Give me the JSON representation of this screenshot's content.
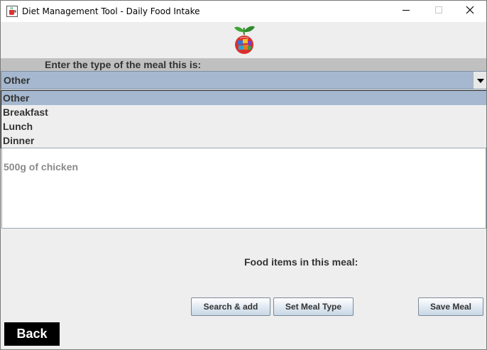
{
  "window": {
    "title": "Diet Management Tool - Daily Food Intake"
  },
  "icons": {
    "app": "java-cup-icon",
    "logo": "apple-plant-logo",
    "minimize": "minimize-icon",
    "maximize": "maximize-icon",
    "close": "close-icon",
    "dropdown": "triangle-down-icon"
  },
  "meal_type": {
    "prompt": "Enter the type of the meal this is:",
    "selected": "Other",
    "options": [
      "Other",
      "Breakfast",
      "Lunch",
      "Dinner"
    ]
  },
  "food_entry": {
    "text": "500g of chicken"
  },
  "items_label": "Food items in this meal:",
  "buttons": {
    "search_add": "Search & add",
    "set_meal_type": "Set Meal Type",
    "save_meal": "Save Meal",
    "back": "Back"
  },
  "colors": {
    "selection": "#a5b8cf",
    "prompt_bar": "#c0c0c0",
    "back_button": "#000000"
  }
}
